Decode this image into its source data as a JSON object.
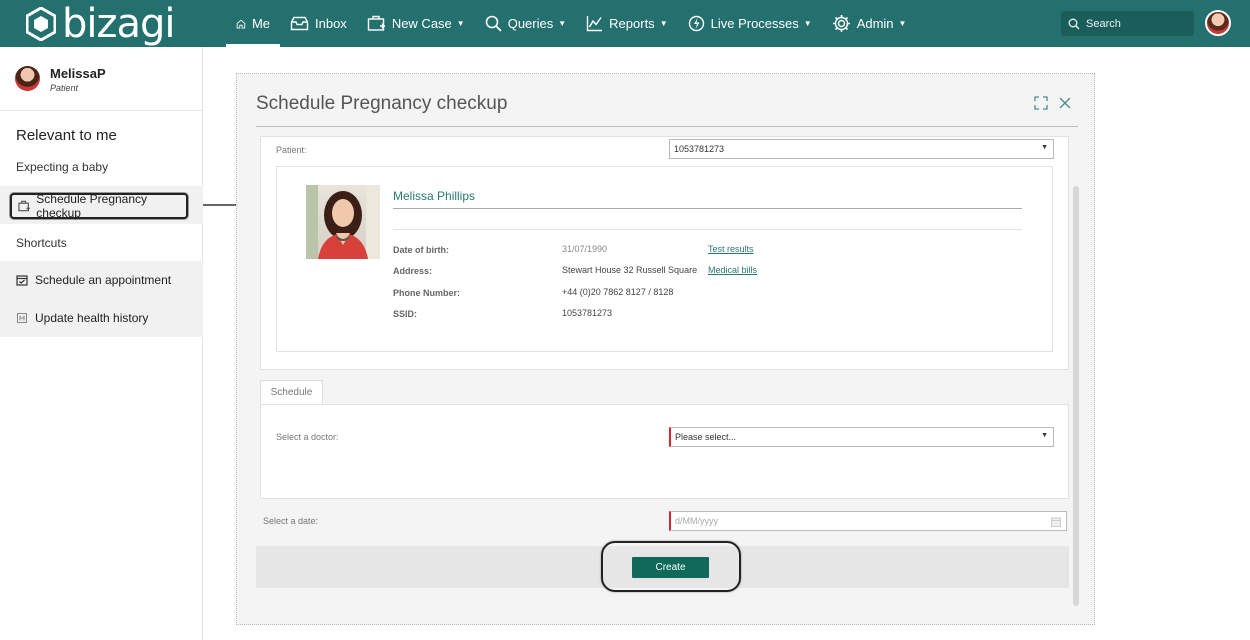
{
  "app": {
    "logo_text": "bizagi"
  },
  "nav": {
    "items": [
      {
        "label": "Me",
        "icon": "home-icon",
        "active": true
      },
      {
        "label": "Inbox",
        "icon": "inbox-icon"
      },
      {
        "label": "New Case",
        "icon": "new-case-icon"
      },
      {
        "label": "Queries",
        "icon": "search-icon"
      },
      {
        "label": "Reports",
        "icon": "reports-icon"
      },
      {
        "label": "Live Processes",
        "icon": "live-processes-icon"
      },
      {
        "label": "Admin",
        "icon": "gear-icon"
      }
    ],
    "search_placeholder": "Search"
  },
  "sidebar": {
    "user": {
      "name": "MelissaP",
      "role": "Patient"
    },
    "relevant_title": "Relevant to me",
    "expecting": "Expecting a baby",
    "active_item": "Schedule Pregnancy checkup",
    "shortcuts_title": "Shortcuts",
    "shortcuts": [
      {
        "label": "Schedule an appointment",
        "icon": "calendar-check-icon"
      },
      {
        "label": "Update health history",
        "icon": "history-icon"
      }
    ]
  },
  "modal": {
    "title": "Schedule Pregnancy checkup",
    "patient_label": "Patient:",
    "patient_value": "1053781273",
    "patient_name": "Melissa Phillips",
    "details": [
      {
        "label": "Date of birth:",
        "value": "31/07/1990",
        "link": "Test results"
      },
      {
        "label": "Address:",
        "value": "Stewart House 32 Russell Square",
        "link": "Medical bills"
      },
      {
        "label": "Phone Number:",
        "value": "+44 (0)20 7862 8127 / 8128",
        "link": ""
      },
      {
        "label": "SSID:",
        "value": "1053781273",
        "link": ""
      }
    ],
    "tab_label": "Schedule",
    "doctor_label": "Select a doctor:",
    "doctor_placeholder": "Please select...",
    "date_label": "Select a date:",
    "date_placeholder": "d/MM/yyyy",
    "create_label": "Create"
  },
  "colors": {
    "topbar": "#23706e",
    "accent": "#0f6a5a",
    "required": "#d9232d"
  }
}
